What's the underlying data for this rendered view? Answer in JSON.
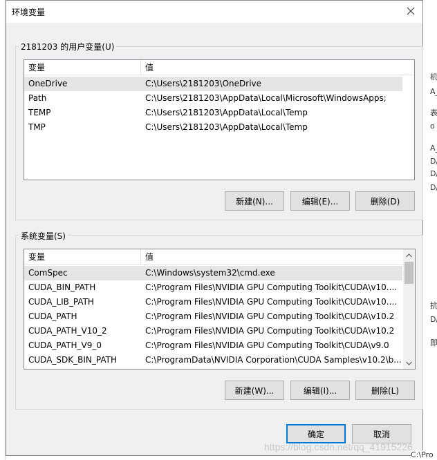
{
  "dialog": {
    "title": "环境变量",
    "close_glyph": "✕"
  },
  "user_vars": {
    "group_label": "2181203 的用户变量(U)",
    "col_variable": "变量",
    "col_value": "值",
    "rows": [
      {
        "name": "OneDrive",
        "value": "C:\\Users\\2181203\\OneDrive",
        "selected": true
      },
      {
        "name": "Path",
        "value": "C:\\Users\\2181203\\AppData\\Local\\Microsoft\\WindowsApps;"
      },
      {
        "name": "TEMP",
        "value": "C:\\Users\\2181203\\AppData\\Local\\Temp"
      },
      {
        "name": "TMP",
        "value": "C:\\Users\\2181203\\AppData\\Local\\Temp"
      }
    ],
    "btn_new": "新建(N)...",
    "btn_edit": "编辑(E)...",
    "btn_delete": "删除(D)"
  },
  "system_vars": {
    "group_label": "系统变量(S)",
    "col_variable": "变量",
    "col_value": "值",
    "rows": [
      {
        "name": "ComSpec",
        "value": "C:\\Windows\\system32\\cmd.exe",
        "selected": true
      },
      {
        "name": "CUDA_BIN_PATH",
        "value": "C:\\Program Files\\NVIDIA GPU Computing Toolkit\\CUDA\\v10...."
      },
      {
        "name": "CUDA_LIB_PATH",
        "value": "C:\\Program Files\\NVIDIA GPU Computing Toolkit\\CUDA\\v10...."
      },
      {
        "name": "CUDA_PATH",
        "value": "C:\\Program Files\\NVIDIA GPU Computing Toolkit\\CUDA\\v10.2"
      },
      {
        "name": "CUDA_PATH_V10_2",
        "value": "C:\\Program Files\\NVIDIA GPU Computing Toolkit\\CUDA\\v10.2"
      },
      {
        "name": "CUDA_PATH_V9_0",
        "value": "C:\\Program Files\\NVIDIA GPU Computing Toolkit\\CUDA\\v9.0"
      },
      {
        "name": "CUDA_SDK_BIN_PATH",
        "value": "C:\\ProgramData\\NVIDIA Corporation\\CUDA Samples\\v10.2\\b..."
      }
    ],
    "btn_new": "新建(W)...",
    "btn_edit": "编辑(I)...",
    "btn_delete": "删除(L)"
  },
  "footer": {
    "btn_ok": "确定",
    "btn_cancel": "取消"
  },
  "watermark": "https://blog.csdn.net/qq_41915226",
  "background": {
    "right_snippets": [
      "机",
      "A_",
      "表",
      "o",
      "A_",
      "D/",
      "D/",
      "D/",
      "抗",
      "D/",
      "即"
    ],
    "bottom_text": "C:\\Pro"
  },
  "colors": {
    "dialog_bg": "#f0f0f0",
    "selected_row": "#e5e5e5",
    "default_button_border": "#0078d7"
  }
}
